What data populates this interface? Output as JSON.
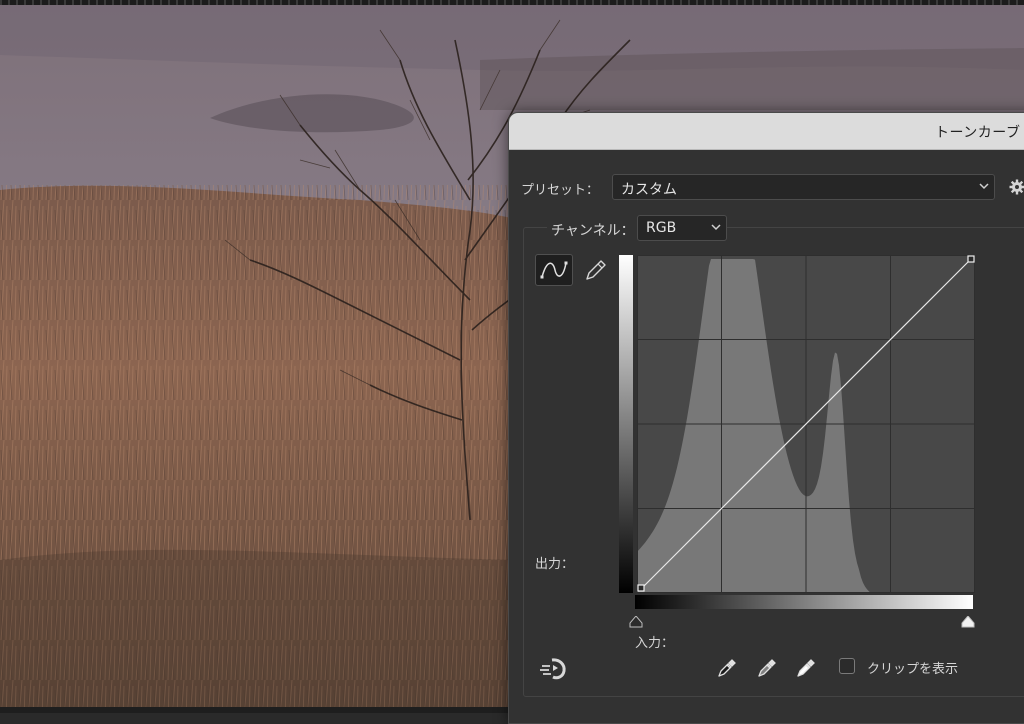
{
  "dialog": {
    "title": "トーンカーブ",
    "preset_label": "プリセット：",
    "preset_value": "カスタム",
    "channel_label": "チャンネル：",
    "channel_value": "RGB",
    "output_label": "出力：",
    "input_label": "入力：",
    "clip_label": "クリップを表示",
    "clip_checked": false,
    "tools": [
      "curve-point-tool",
      "pencil-draw-tool"
    ],
    "eyedroppers": [
      "black-point-eyedropper-icon",
      "gray-point-eyedropper-icon",
      "white-point-eyedropper-icon"
    ]
  },
  "colors": {
    "dialog_bg": "#323232",
    "titlebar_bg": "#dcdcdc",
    "histogram": "#777777",
    "graph_bg": "#4a4a4a",
    "curve": "#e8e8e8"
  },
  "curve": {
    "points": [
      [
        0,
        0
      ],
      [
        255,
        255
      ]
    ]
  }
}
